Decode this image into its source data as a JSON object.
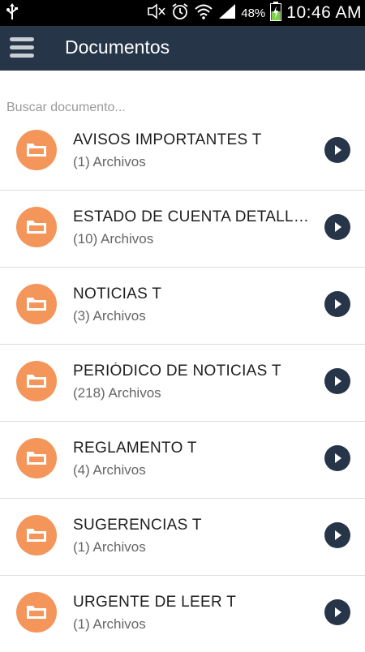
{
  "status_bar": {
    "battery_percent": "48%",
    "time": "10:46 AM",
    "icons": [
      "usb-icon",
      "mute-icon",
      "alarm-icon",
      "wifi-icon",
      "signal-icon",
      "battery-charging-icon"
    ]
  },
  "header": {
    "title": "Documentos",
    "menu_icon": "hamburger-menu-icon"
  },
  "search": {
    "placeholder": "Buscar documento..."
  },
  "folders": [
    {
      "name": "AVISOS IMPORTANTES T",
      "count": "(1) Archivos"
    },
    {
      "name": "ESTADO DE CUENTA DETALLADO T",
      "count": "(10) Archivos"
    },
    {
      "name": "NOTICIAS T",
      "count": "(3) Archivos"
    },
    {
      "name": "PERIÓDICO DE NOTICIAS T",
      "count": "(218) Archivos"
    },
    {
      "name": "REGLAMENTO T",
      "count": "(4) Archivos"
    },
    {
      "name": "SUGERENCIAS T",
      "count": "(1) Archivos"
    },
    {
      "name": "URGENTE DE LEER T",
      "count": "(1) Archivos"
    }
  ],
  "colors": {
    "app_bar": "#263548",
    "folder_circle": "#f4955a",
    "action_button": "#263548"
  }
}
